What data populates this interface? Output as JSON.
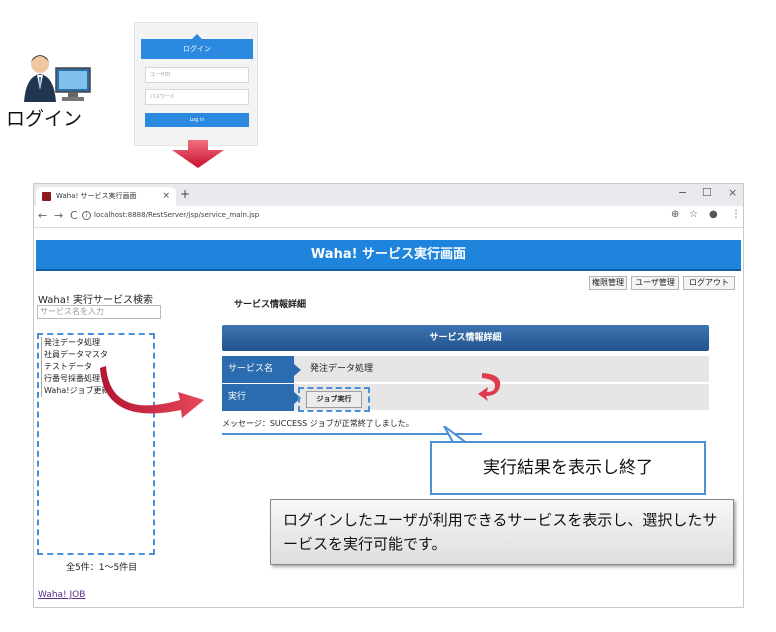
{
  "top": {
    "login_caption": "ログイン",
    "login_card": {
      "header": "ログイン",
      "user_placeholder": "ユーザID",
      "password_placeholder": "パスワード",
      "button": "Log in"
    }
  },
  "browser": {
    "tab_title": "Waha! サービス実行画面",
    "tab_close": "×",
    "new_tab": "+",
    "window_controls": [
      "−",
      "☐",
      "×"
    ],
    "nav": [
      "←",
      "→",
      "C"
    ],
    "url": "localhost:8888/RestServer/jsp/service_main.jsp",
    "right_icons": [
      "⊕",
      "☆",
      "●",
      "⋮"
    ]
  },
  "page": {
    "header_title": "Waha! サービス実行画面",
    "top_buttons": [
      "権限管理",
      "ユーザ管理",
      "ログアウト"
    ],
    "sidebar": {
      "title": "Waha! 実行サービス検索",
      "search_placeholder": "サービス名を入力",
      "items": [
        "発注データ処理",
        "社員データマスタ",
        "テストデータ",
        "行番号採番処理",
        "Waha!ジョブ更新"
      ],
      "count_text": "全5件：1〜5件目",
      "link": "Waha! JOB"
    },
    "main": {
      "title": "サービス情報詳細",
      "panel_header": "サービス情報詳細",
      "rows": [
        {
          "label": "サービス名",
          "value": "発注データ処理"
        },
        {
          "label": "実行",
          "button": "ジョブ実行"
        }
      ],
      "message": "メッセージ：SUCCESS ジョブが正常終了しました。"
    }
  },
  "annotations": {
    "callout": "実行結果を表示し終了",
    "description": "ログインしたユーザが利用できるサービスを表示し、選択したサービスを実行可能です。"
  },
  "colors": {
    "header_blue": "#1e84dc",
    "label_blue": "#2b6cb0",
    "dashed_blue": "#4a90d9",
    "arrow_red": "#d9384a"
  }
}
